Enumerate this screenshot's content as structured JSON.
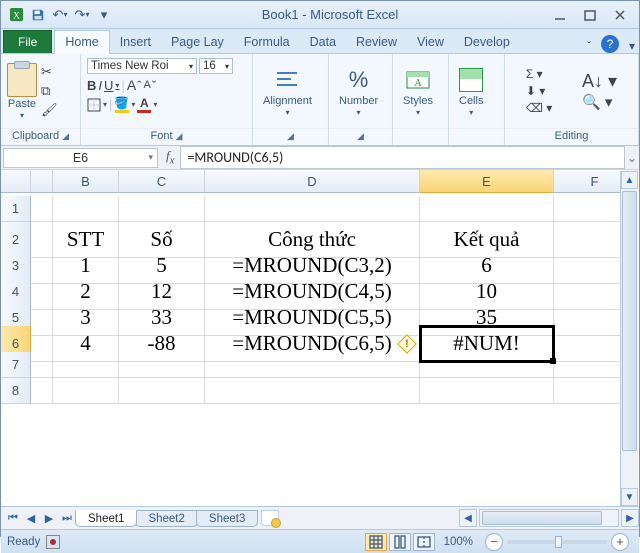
{
  "title": "Book1 - Microsoft Excel",
  "qat": {
    "dropdown": "▾"
  },
  "tabs": {
    "file": "File",
    "items": [
      "Home",
      "Insert",
      "Page Lay",
      "Formula",
      "Data",
      "Review",
      "View",
      "Develop"
    ],
    "active_index": 0
  },
  "ribbon": {
    "clipboard": {
      "paste": "Paste",
      "label": "Clipboard"
    },
    "font": {
      "name": "Times New Roi",
      "size": "16",
      "label": "Font",
      "bold": "B",
      "italic": "I",
      "underline": "U",
      "grow": "A",
      "shrink": "A"
    },
    "alignment": {
      "label": "Alignment"
    },
    "number": {
      "label": "Number",
      "glyph": "%"
    },
    "styles": {
      "label": "Styles"
    },
    "cells": {
      "label": "Cells"
    },
    "editing": {
      "label": "Editing",
      "sigma": "Σ",
      "fill": "⬇",
      "clear": "⌫"
    }
  },
  "namebox": "E6",
  "formula": "=MROUND(C6,5)",
  "columns": [
    "",
    "B",
    "C",
    "D",
    "E",
    "F"
  ],
  "rows": [
    "1",
    "2",
    "3",
    "4",
    "5",
    "6",
    "7",
    "8"
  ],
  "data": {
    "headers": {
      "B": "STT",
      "C": "Số",
      "D": "Công thức",
      "E": "Kết quả"
    },
    "rows": [
      {
        "B": "1",
        "C": "5",
        "D": "=MROUND(C3,2)",
        "E": "6"
      },
      {
        "B": "2",
        "C": "12",
        "D": "=MROUND(C4,5)",
        "E": "10"
      },
      {
        "B": "3",
        "C": "33",
        "D": "=MROUND(C5,5)",
        "E": "35"
      },
      {
        "B": "4",
        "C": "-88",
        "D": "=MROUND(C6,5)",
        "E": "#NUM!"
      }
    ]
  },
  "sheets": {
    "items": [
      "Sheet1",
      "Sheet2",
      "Sheet3"
    ],
    "active_index": 0
  },
  "status": {
    "mode": "Ready",
    "zoom": "100%"
  }
}
